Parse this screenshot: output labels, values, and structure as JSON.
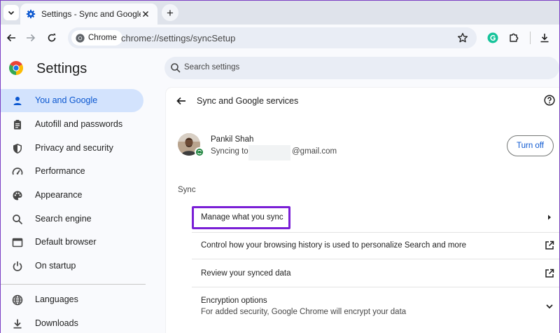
{
  "browser": {
    "tab_title": "Settings - Sync and Google services",
    "new_tab_symbol": "+",
    "chip_label": "Chrome",
    "url": "chrome://settings/syncSetup"
  },
  "header": {
    "title": "Settings",
    "search_placeholder": "Search settings"
  },
  "sidebar": {
    "items": [
      {
        "label": "You and Google",
        "icon": "person-icon"
      },
      {
        "label": "Autofill and passwords",
        "icon": "clipboard-icon"
      },
      {
        "label": "Privacy and security",
        "icon": "shield-icon"
      },
      {
        "label": "Performance",
        "icon": "gauge-icon"
      },
      {
        "label": "Appearance",
        "icon": "palette-icon"
      },
      {
        "label": "Search engine",
        "icon": "search-icon"
      },
      {
        "label": "Default browser",
        "icon": "browser-window-icon"
      },
      {
        "label": "On startup",
        "icon": "power-icon"
      },
      {
        "label": "Languages",
        "icon": "globe-icon"
      },
      {
        "label": "Downloads",
        "icon": "download-icon"
      }
    ]
  },
  "main": {
    "page_title": "Sync and Google services",
    "account": {
      "name": "Pankil Shah",
      "syncing_prefix": "Syncing to",
      "email_suffix": "@gmail.com",
      "turn_off_label": "Turn off"
    },
    "section_label": "Sync",
    "rows": {
      "manage": "Manage what you sync",
      "history": "Control how your browsing history is used to personalize Search and more",
      "review": "Review your synced data",
      "encryption_title": "Encryption options",
      "encryption_sub": "For added security, Google Chrome will encrypt your data"
    }
  },
  "colors": {
    "accent": "#0b57d0",
    "active_nav_bg": "#d3e3fd",
    "highlight_box": "#7a1fd6",
    "sync_badge": "#188038"
  }
}
